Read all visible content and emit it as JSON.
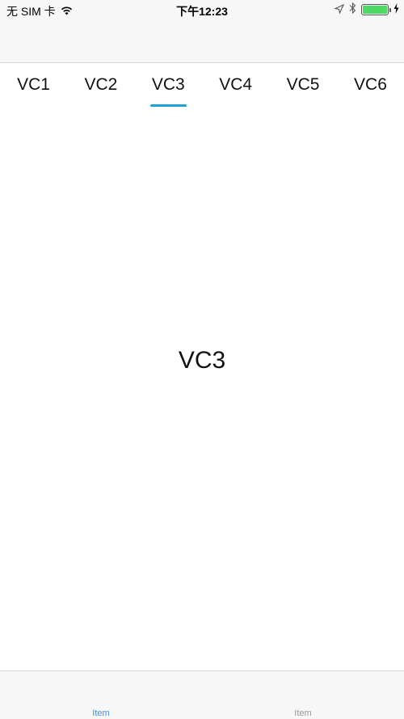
{
  "status_bar": {
    "carrier": "无 SIM 卡",
    "time": "下午12:23",
    "battery_color": "#4cd964",
    "icons": [
      "wifi-icon",
      "location-icon",
      "bluetooth-icon",
      "battery-icon",
      "charging-icon"
    ]
  },
  "tabs": [
    {
      "label": "VC1",
      "selected": false
    },
    {
      "label": "VC2",
      "selected": false
    },
    {
      "label": "VC3",
      "selected": true
    },
    {
      "label": "VC4",
      "selected": false
    },
    {
      "label": "VC5",
      "selected": false
    },
    {
      "label": "VC6",
      "selected": false
    }
  ],
  "indicator_color": "#1aa3d4",
  "content": {
    "label": "VC3"
  },
  "bottom_bar": {
    "items": [
      {
        "label": "Item",
        "selected": true,
        "color": "#3b8fe0"
      },
      {
        "label": "Item",
        "selected": false,
        "color": "#999999"
      }
    ]
  }
}
